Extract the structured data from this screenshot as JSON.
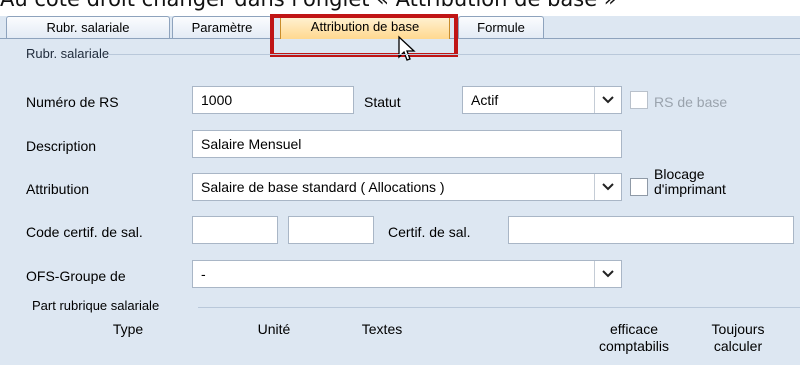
{
  "caption": "Au côté droit changer dans l'onglet « Attribution de base »",
  "tabs": [
    {
      "label": "Rubr. salariale",
      "active": false
    },
    {
      "label": "Paramètre",
      "active": false
    },
    {
      "label": "Attribution de base",
      "active": true
    },
    {
      "label": "Formule",
      "active": false
    }
  ],
  "group": {
    "title": "Rubr. salariale",
    "numero_label": "Numéro de RS",
    "numero_value": "1000",
    "statut_label": "Statut",
    "statut_value": "Actif",
    "rs_base_label": "RS de base",
    "description_label": "Description",
    "description_value": "Salaire Mensuel",
    "attribution_label": "Attribution",
    "attribution_value": "Salaire de base standard ( Allocations )",
    "blocage_label": "Blocage d'imprimant",
    "code_certif_label": "Code certif. de sal.",
    "code_certif_value1": "",
    "code_certif_value2": "",
    "certif_label": "Certif. de sal.",
    "certif_value": "",
    "ofs_label": "OFS-Groupe de",
    "ofs_value": "-"
  },
  "part": {
    "title": "Part rubrique salariale",
    "col_type": "Type",
    "col_unite": "Unité",
    "col_textes": "Textes",
    "col_efficace": "efficace comptabilis",
    "col_toujours": "Toujours calculer"
  },
  "colors": {
    "highlight": "#c01515",
    "active_tab": "#ffd88f",
    "window_bg": "#dde7f2"
  }
}
